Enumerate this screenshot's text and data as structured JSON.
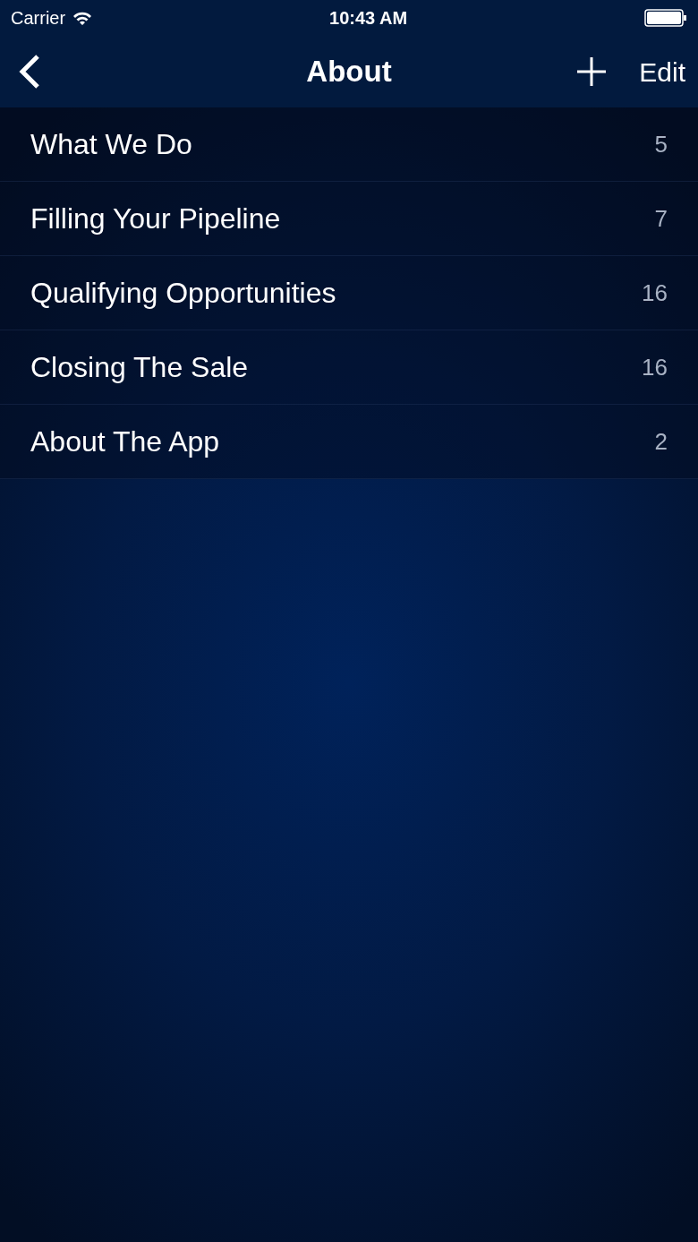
{
  "status_bar": {
    "carrier": "Carrier",
    "time": "10:43 AM"
  },
  "nav_bar": {
    "title": "About",
    "edit": "Edit"
  },
  "items": [
    {
      "label": "What We Do",
      "count": "5"
    },
    {
      "label": "Filling Your Pipeline",
      "count": "7"
    },
    {
      "label": "Qualifying Opportunities",
      "count": "16"
    },
    {
      "label": "Closing The Sale",
      "count": "16"
    },
    {
      "label": "About The App",
      "count": "2"
    }
  ]
}
